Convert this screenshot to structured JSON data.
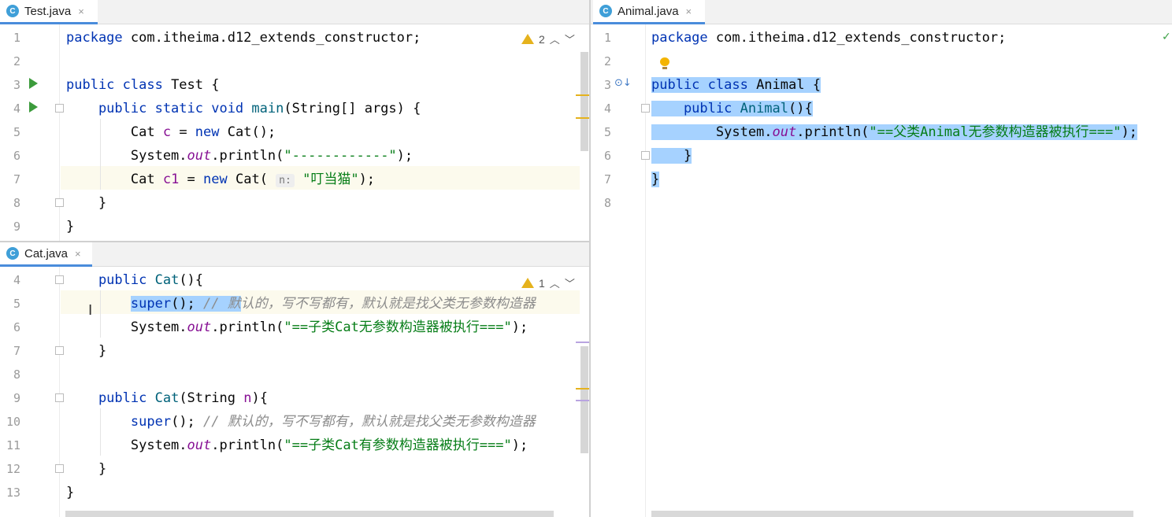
{
  "panes": {
    "test": {
      "tab": {
        "icon": "C",
        "title": "Test.java",
        "close": "×"
      },
      "inspection": {
        "count": "2"
      },
      "lines": [
        {
          "n": "1",
          "segs": [
            {
              "t": "package ",
              "c": "kw"
            },
            {
              "t": "com.itheima.d12_extends_constructor;",
              "c": ""
            }
          ]
        },
        {
          "n": "2",
          "segs": []
        },
        {
          "n": "3",
          "segs": [
            {
              "t": "public class ",
              "c": "kw"
            },
            {
              "t": "Test {",
              "c": ""
            }
          ]
        },
        {
          "n": "4",
          "segs": [
            {
              "t": "    public static void ",
              "c": "kw"
            },
            {
              "t": "main",
              "c": "fn"
            },
            {
              "t": "(String[] args) {",
              "c": ""
            }
          ]
        },
        {
          "n": "5",
          "segs": [
            {
              "t": "        Cat ",
              "c": ""
            },
            {
              "t": "c",
              "c": "var"
            },
            {
              "t": " = ",
              "c": ""
            },
            {
              "t": "new ",
              "c": "kw"
            },
            {
              "t": "Cat();",
              "c": ""
            }
          ]
        },
        {
          "n": "6",
          "segs": [
            {
              "t": "        System.",
              "c": ""
            },
            {
              "t": "out",
              "c": "ital"
            },
            {
              "t": ".println(",
              "c": ""
            },
            {
              "t": "\"------------\"",
              "c": "str"
            },
            {
              "t": ");",
              "c": ""
            }
          ]
        },
        {
          "n": "7",
          "segs": [
            {
              "t": "        Cat ",
              "c": ""
            },
            {
              "t": "c1",
              "c": "var"
            },
            {
              "t": " = ",
              "c": ""
            },
            {
              "t": "new ",
              "c": "kw"
            },
            {
              "t": "Cat( ",
              "c": ""
            },
            {
              "t": "n:",
              "c": "hint"
            },
            {
              "t": " ",
              "c": ""
            },
            {
              "t": "\"叮当猫\"",
              "c": "str"
            },
            {
              "t": ");",
              "c": ""
            }
          ]
        },
        {
          "n": "8",
          "segs": [
            {
              "t": "    }",
              "c": ""
            }
          ]
        },
        {
          "n": "9",
          "segs": [
            {
              "t": "}",
              "c": ""
            }
          ]
        }
      ]
    },
    "cat": {
      "tab": {
        "icon": "C",
        "title": "Cat.java",
        "close": "×"
      },
      "inspection": {
        "count": "1"
      },
      "lines": [
        {
          "n": "4",
          "segs": [
            {
              "t": "    public ",
              "c": "kw"
            },
            {
              "t": "Cat",
              "c": "fn"
            },
            {
              "t": "(){",
              "c": ""
            }
          ]
        },
        {
          "n": "5",
          "segs": [
            {
              "t": "        ",
              "c": ""
            },
            {
              "t": "super",
              "c": "kw sel"
            },
            {
              "t": "(); ",
              "c": "sel"
            },
            {
              "t": "// 默",
              "c": "cmt sel"
            },
            {
              "t": "认的，写不写都有，默认就是找父类无参数构造器",
              "c": "cmt"
            }
          ]
        },
        {
          "n": "6",
          "segs": [
            {
              "t": "        System.",
              "c": ""
            },
            {
              "t": "out",
              "c": "ital"
            },
            {
              "t": ".println(",
              "c": ""
            },
            {
              "t": "\"==子类Cat无参数构造器被执行===\"",
              "c": "str"
            },
            {
              "t": ");",
              "c": ""
            }
          ]
        },
        {
          "n": "7",
          "segs": [
            {
              "t": "    }",
              "c": ""
            }
          ]
        },
        {
          "n": "8",
          "segs": []
        },
        {
          "n": "9",
          "segs": [
            {
              "t": "    public ",
              "c": "kw"
            },
            {
              "t": "Cat",
              "c": "fn"
            },
            {
              "t": "(String ",
              "c": ""
            },
            {
              "t": "n",
              "c": "var"
            },
            {
              "t": "){",
              "c": ""
            }
          ]
        },
        {
          "n": "10",
          "segs": [
            {
              "t": "        ",
              "c": ""
            },
            {
              "t": "super",
              "c": "kw"
            },
            {
              "t": "(); ",
              "c": ""
            },
            {
              "t": "// 默认的，写不写都有，默认就是找父类无参数构造器",
              "c": "cmt"
            }
          ]
        },
        {
          "n": "11",
          "segs": [
            {
              "t": "        System.",
              "c": ""
            },
            {
              "t": "out",
              "c": "ital"
            },
            {
              "t": ".println(",
              "c": ""
            },
            {
              "t": "\"==子类Cat有参数构造器被执行===\"",
              "c": "str"
            },
            {
              "t": ");",
              "c": ""
            }
          ]
        },
        {
          "n": "12",
          "segs": [
            {
              "t": "    }",
              "c": ""
            }
          ]
        },
        {
          "n": "13",
          "segs": [
            {
              "t": "}",
              "c": ""
            }
          ]
        }
      ]
    },
    "animal": {
      "tab": {
        "icon": "C",
        "title": "Animal.java",
        "close": "×"
      },
      "lines": [
        {
          "n": "1",
          "segs": [
            {
              "t": "package ",
              "c": "kw"
            },
            {
              "t": "com.itheima.d12_extends_constructor;",
              "c": ""
            }
          ]
        },
        {
          "n": "2",
          "segs": []
        },
        {
          "n": "3",
          "segs": [
            {
              "t": "public class ",
              "c": "kw sel"
            },
            {
              "t": "Animal {",
              "c": "sel"
            }
          ]
        },
        {
          "n": "4",
          "segs": [
            {
              "t": "    public ",
              "c": "kw sel"
            },
            {
              "t": "Animal",
              "c": "fn sel"
            },
            {
              "t": "(){",
              "c": "sel"
            }
          ]
        },
        {
          "n": "5",
          "segs": [
            {
              "t": "        System.",
              "c": "sel"
            },
            {
              "t": "out",
              "c": "ital sel"
            },
            {
              "t": ".println(",
              "c": "sel"
            },
            {
              "t": "\"==父类Animal无参数构造器被执行===\"",
              "c": "str sel"
            },
            {
              "t": ");",
              "c": "sel"
            }
          ]
        },
        {
          "n": "6",
          "segs": [
            {
              "t": "    }",
              "c": "sel"
            }
          ]
        },
        {
          "n": "7",
          "segs": [
            {
              "t": "}",
              "c": "sel"
            }
          ]
        },
        {
          "n": "8",
          "segs": []
        }
      ]
    }
  },
  "colors": {
    "keyword": "#0033b3",
    "string": "#067d17",
    "comment": "#8c8c8c",
    "selection": "#a6d2ff",
    "tab_accent": "#4a8cdb"
  }
}
